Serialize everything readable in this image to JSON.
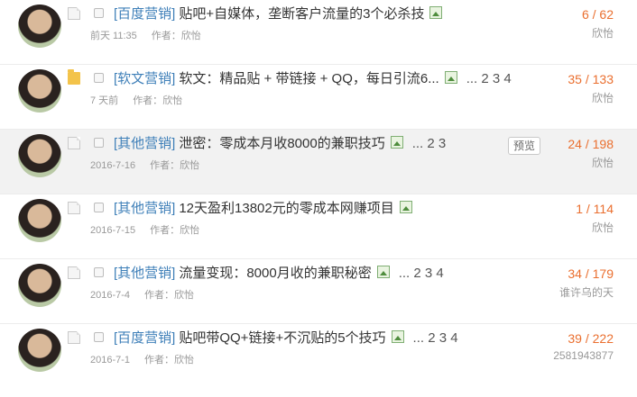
{
  "threads": [
    {
      "icon": "doc-icon",
      "category": "[百度营销]",
      "title": "贴吧+自媒体，垄断客户流量的3个必杀技",
      "pages": "",
      "date": "前天 11:35",
      "author_label": "作者：",
      "author": "欣怡",
      "replies": "6",
      "views": "62",
      "last_poster": "欣怡",
      "preview": ""
    },
    {
      "icon": "folder-icon",
      "category": "[软文营销]",
      "title": "软文：精品贴 + 带链接 + QQ，每日引流6...",
      "pages": "... 2 3 4",
      "date": "7 天前",
      "author_label": "作者：",
      "author": "欣怡",
      "replies": "35",
      "views": "133",
      "last_poster": "欣怡",
      "preview": ""
    },
    {
      "icon": "doc-icon",
      "category": "[其他营销]",
      "title": "泄密：零成本月收8000的兼职技巧",
      "pages": "... 2 3",
      "date": "2016-7-16",
      "author_label": "作者：",
      "author": "欣怡",
      "replies": "24",
      "views": "198",
      "last_poster": "欣怡",
      "preview": "预览"
    },
    {
      "icon": "doc-icon",
      "category": "[其他营销]",
      "title": "12天盈利13802元的零成本网赚项目",
      "pages": "",
      "date": "2016-7-15",
      "author_label": "作者：",
      "author": "欣怡",
      "replies": "1",
      "views": "114",
      "last_poster": "欣怡",
      "preview": ""
    },
    {
      "icon": "doc-icon",
      "category": "[其他营销]",
      "title": "流量变现：8000月收的兼职秘密",
      "pages": "... 2 3 4",
      "date": "2016-7-4",
      "author_label": "作者：",
      "author": "欣怡",
      "replies": "34",
      "views": "179",
      "last_poster": "谁许乌的天",
      "preview": ""
    },
    {
      "icon": "doc-icon",
      "category": "[百度营销]",
      "title": "贴吧带QQ+链接+不沉贴的5个技巧",
      "pages": "... 2 3 4",
      "date": "2016-7-1",
      "author_label": "作者：",
      "author": "欣怡",
      "replies": "39",
      "views": "222",
      "last_poster": "2581943877",
      "preview": ""
    }
  ],
  "colors": {
    "category": "#3e7fb8",
    "count": "#ea6f2f",
    "meta": "#999999"
  }
}
